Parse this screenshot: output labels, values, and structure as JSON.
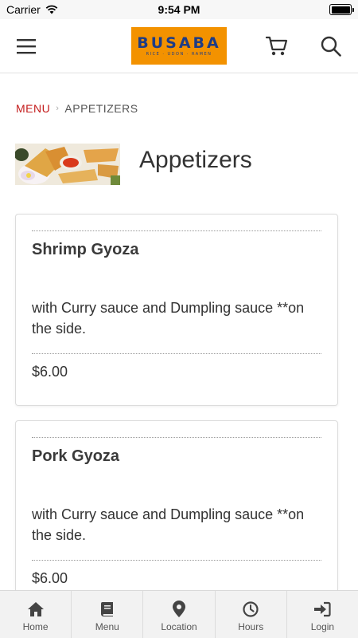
{
  "status_bar": {
    "carrier": "Carrier",
    "time": "9:54 PM"
  },
  "header": {
    "logo": {
      "name": "BUSABA",
      "tagline": "RICE · UDON · RAMEN"
    },
    "colors": {
      "logo_bg": "#f39200",
      "logo_text": "#1d3c86"
    },
    "icons": [
      "hamburger-menu-icon",
      "cart-icon",
      "search-icon"
    ]
  },
  "breadcrumb": {
    "parent": "MENU",
    "current": "APPETIZERS",
    "parent_color": "#c41c1c"
  },
  "category": {
    "title": "Appetizers"
  },
  "items": [
    {
      "name": "Shrimp Gyoza",
      "description": "with Curry sauce and Dumpling sauce **on the side.",
      "price": "$6.00"
    },
    {
      "name": "Pork Gyoza",
      "description": "with Curry sauce and Dumpling sauce **on the side.",
      "price": "$6.00"
    }
  ],
  "tab_bar": {
    "tabs": [
      {
        "label": "Home",
        "icon": "home-icon"
      },
      {
        "label": "Menu",
        "icon": "book-icon"
      },
      {
        "label": "Location",
        "icon": "map-pin-icon"
      },
      {
        "label": "Hours",
        "icon": "clock-icon"
      },
      {
        "label": "Login",
        "icon": "sign-in-icon"
      }
    ]
  }
}
